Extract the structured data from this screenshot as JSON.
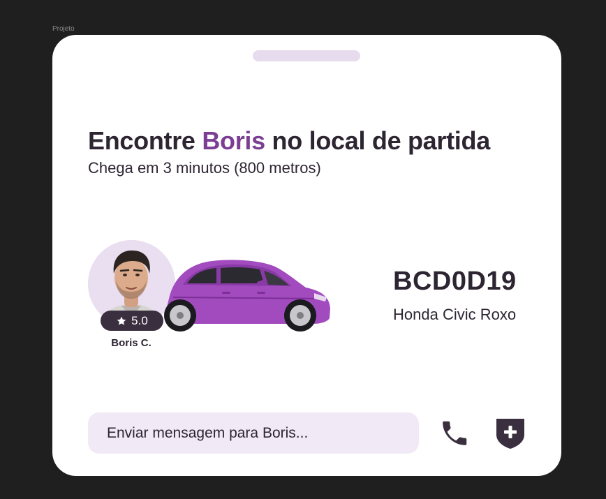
{
  "frame": {
    "label": "Projeto"
  },
  "headline": {
    "prefix": "Encontre ",
    "driver_name": "Boris",
    "suffix": " no local de partida"
  },
  "arrival": {
    "text": "Chega em 3 minutos (800 metros)"
  },
  "driver": {
    "name": "Boris C.",
    "rating": "5.0"
  },
  "vehicle": {
    "plate": "BCD0D19",
    "model": "Honda Civic Roxo",
    "color": "#a24bbf"
  },
  "message": {
    "placeholder": "Enviar mensagem para Boris..."
  },
  "icons": {
    "phone": "phone-icon",
    "safety": "shield-plus-icon",
    "rating": "star-icon"
  },
  "colors": {
    "accent": "#7b3e93",
    "text": "#2e2533",
    "input_bg": "#f1e9f5",
    "handle": "#e6dcee",
    "background": "#1f1f1f"
  }
}
